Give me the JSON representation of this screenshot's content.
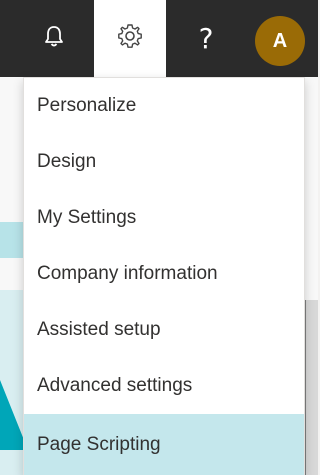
{
  "topbar": {
    "bell_icon": "bell-icon",
    "gear_icon": "gear-icon",
    "help_label": "?",
    "avatar_initial": "A",
    "avatar_color": "#9a6b06",
    "background_color": "#2b2b2b"
  },
  "settings_menu": {
    "items": [
      {
        "label": "Personalize"
      },
      {
        "label": "Design"
      },
      {
        "label": "My Settings"
      },
      {
        "label": "Company information"
      },
      {
        "label": "Assisted setup"
      },
      {
        "label": "Advanced settings"
      },
      {
        "label": "Page Scripting",
        "selected": true
      }
    ],
    "selected_color": "#c4e7ec"
  }
}
